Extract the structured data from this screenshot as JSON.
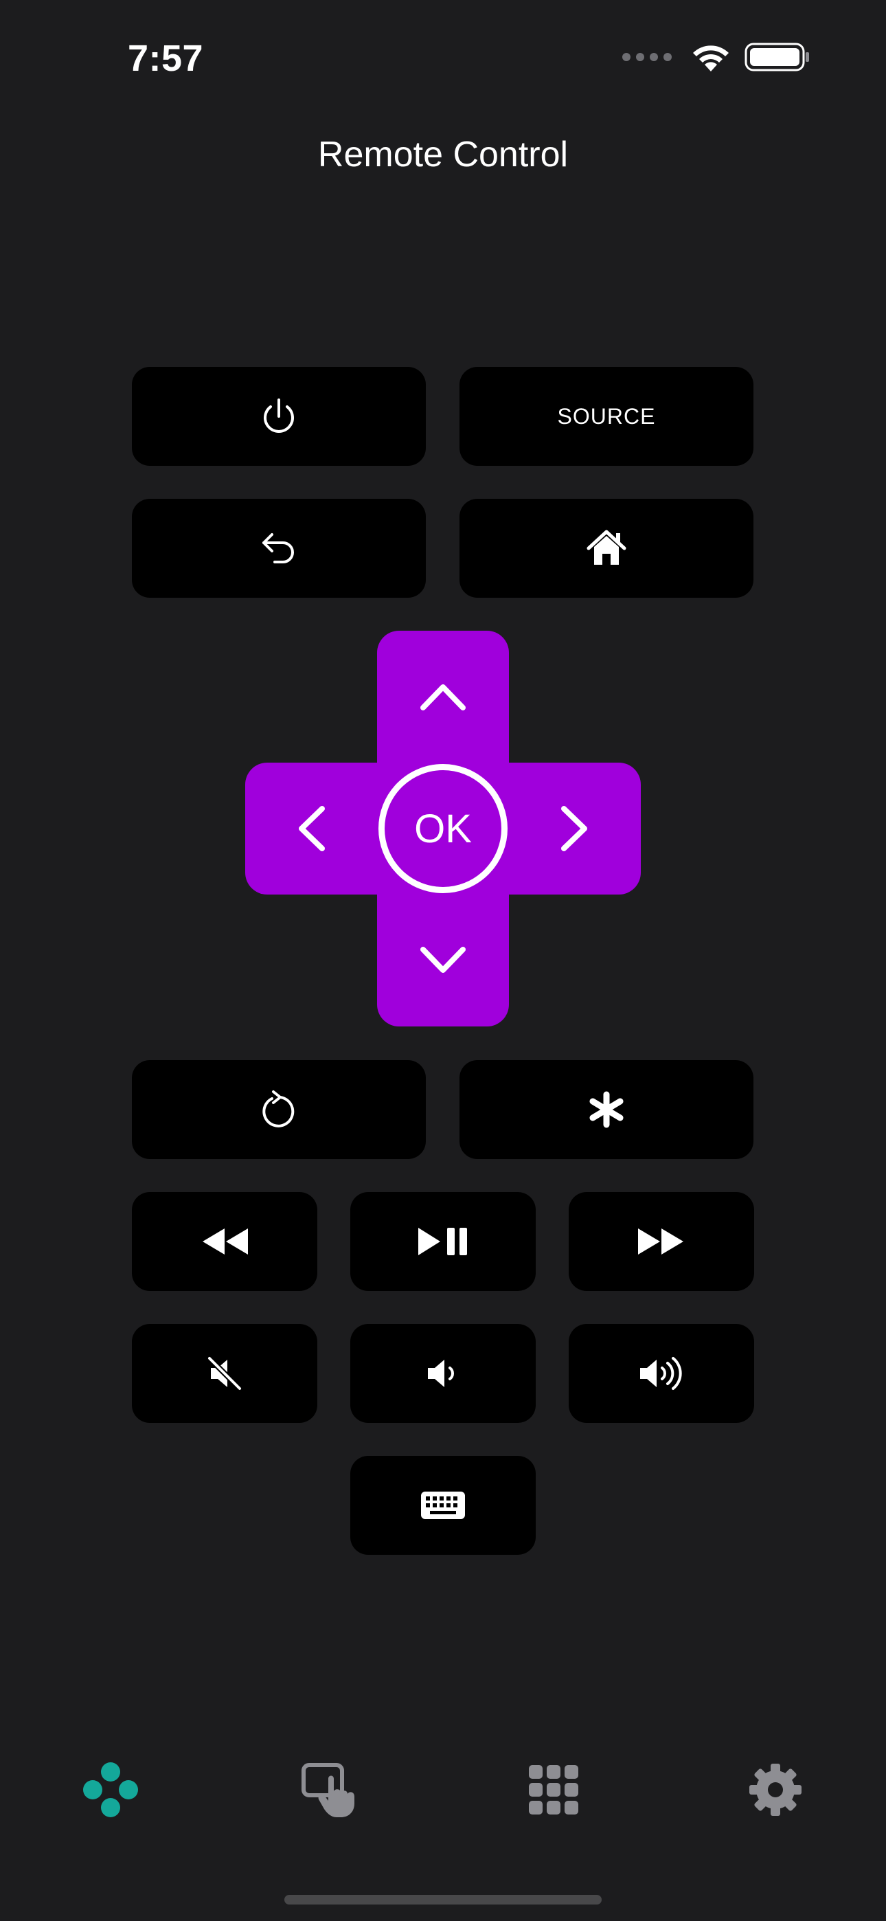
{
  "status_bar": {
    "time": "7:57"
  },
  "header": {
    "title": "Remote Control"
  },
  "buttons": {
    "source_label": "SOURCE",
    "ok_label": "OK"
  },
  "icons": {
    "power": "power-icon",
    "back": "back-arrow-icon",
    "home": "home-icon",
    "up": "chevron-up-icon",
    "down": "chevron-down-icon",
    "left": "chevron-left-icon",
    "right": "chevron-right-icon",
    "replay": "replay-icon",
    "options": "asterisk-icon",
    "rewind": "rewind-icon",
    "play_pause": "play-pause-icon",
    "fast_forward": "fast-forward-icon",
    "mute": "mute-icon",
    "volume_down": "volume-down-icon",
    "volume_up": "volume-up-icon",
    "keyboard": "keyboard-icon"
  },
  "tab_bar": {
    "active_color": "#14a89a",
    "inactive_color": "#8e8e93",
    "tabs": [
      "remote-tab",
      "touchpad-tab",
      "apps-tab",
      "settings-tab"
    ]
  },
  "colors": {
    "background": "#1c1c1e",
    "button": "#000000",
    "dpad": "#a000dc"
  }
}
